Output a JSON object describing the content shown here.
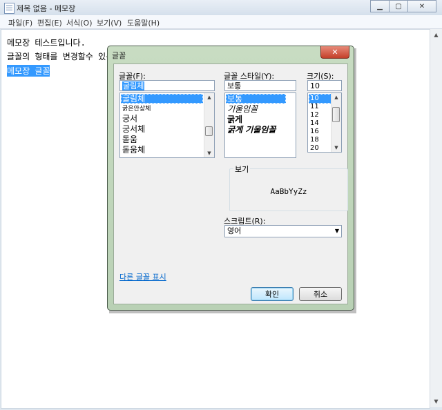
{
  "notepad": {
    "title": "제목 없음 - 메모장",
    "menu": [
      "파일(F)",
      "편집(E)",
      "서식(O)",
      "보기(V)",
      "도움말(H)"
    ],
    "lines": [
      "메모장 테스트입니다.",
      "글꼴의 형태를 변경할수 있는",
      "메모장 글꼴"
    ]
  },
  "font_dialog": {
    "title": "글꼴",
    "font_label": "글꼴(F):",
    "font_value": "굴림체",
    "font_list": [
      "굴림체",
      "굵은안상체",
      "궁서",
      "궁서체",
      "돋움",
      "돋움체"
    ],
    "font_selected_index": 0,
    "style_label": "글꼴 스타일(Y):",
    "style_value": "보통",
    "style_list": [
      "보통",
      "기울임꼴",
      "굵게",
      "굵게 기울임꼴"
    ],
    "style_selected_index": 0,
    "size_label": "크기(S):",
    "size_value": "10",
    "size_list": [
      "10",
      "11",
      "12",
      "14",
      "16",
      "18",
      "20"
    ],
    "size_selected_index": 0,
    "preview_label": "보기",
    "preview_text": "AaBbYyZz",
    "script_label": "스크립트(R):",
    "script_value": "영어",
    "more_fonts_link": "다른 글꼴 표시",
    "ok_label": "확인",
    "cancel_label": "취소"
  }
}
